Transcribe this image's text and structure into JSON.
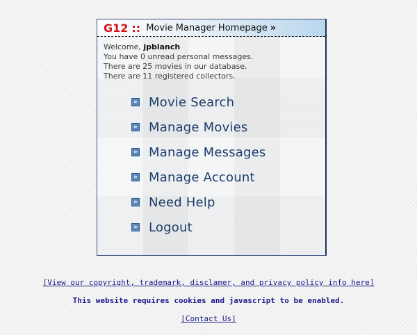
{
  "header": {
    "brand": "G12",
    "separator": "::",
    "title": "Movie Manager Homepage",
    "arrow": "»"
  },
  "info": {
    "welcome_prefix": "Welcome,",
    "username": "jpblanch",
    "line1": "You have 0 unread personal messages.",
    "line2": "There are 25 movies in our database.",
    "line3": "There are 11 registered collectors."
  },
  "menu": [
    {
      "label": "Movie Search",
      "icon": "double-chevron-right-icon"
    },
    {
      "label": "Manage Movies",
      "icon": "double-chevron-right-icon"
    },
    {
      "label": "Manage Messages",
      "icon": "double-chevron-right-icon"
    },
    {
      "label": "Manage Account",
      "icon": "double-chevron-right-icon"
    },
    {
      "label": "Need Help",
      "icon": "double-chevron-right-icon"
    },
    {
      "label": "Logout",
      "icon": "double-chevron-right-icon"
    }
  ],
  "footer": {
    "policy_link": "[View our copyright, trademark, disclamer, and privacy policy info here]",
    "notice": "This website requires cookies and javascript to be enabled.",
    "contact_link": "[Contact Us]"
  },
  "colors": {
    "brand_red": "#d8101a",
    "menu_text": "#1c3d6a",
    "footer_blue": "#1a1a8a",
    "bullet_blue": "#5b86b8"
  }
}
